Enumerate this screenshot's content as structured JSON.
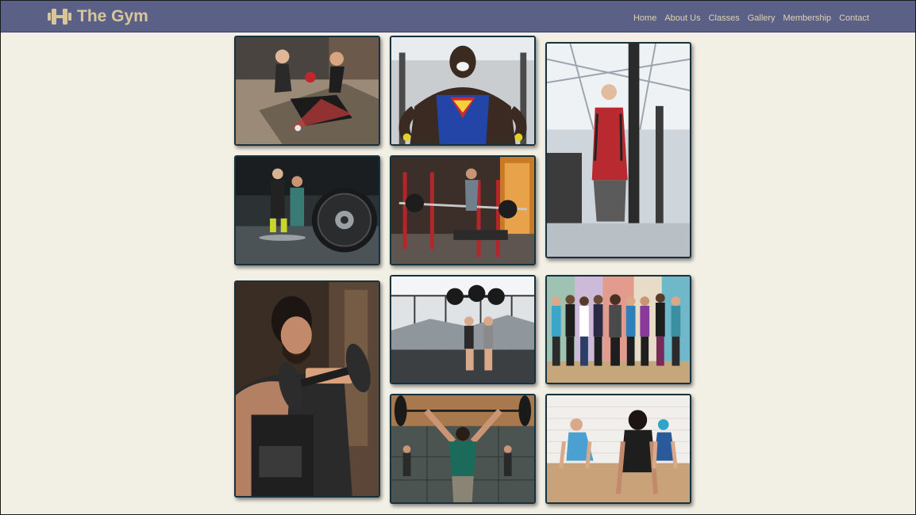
{
  "brand": {
    "name": "The Gym",
    "logo_icon": "dumbbell-icon",
    "color": "#d8c59a"
  },
  "nav": {
    "links": [
      {
        "label": "Home"
      },
      {
        "label": "About Us"
      },
      {
        "label": "Classes"
      },
      {
        "label": "Gallery"
      },
      {
        "label": "Membership"
      },
      {
        "label": "Contact"
      }
    ]
  },
  "gallery": {
    "photos": [
      {
        "subject": "two women exercising with medicine ball"
      },
      {
        "subject": "bodybuilder in superman tank top at cable machine"
      },
      {
        "subject": "man doing cable exercise in gym"
      },
      {
        "subject": "weight plate on barbell with people in background"
      },
      {
        "subject": "man bench pressing with spotter"
      },
      {
        "subject": "bearded man curling dumbbell"
      },
      {
        "subject": "two people lifting barbells overhead"
      },
      {
        "subject": "group of women posing in fitness studio"
      },
      {
        "subject": "man lifting barbell overhead in crossfit gym"
      },
      {
        "subject": "women doing push-ups in studio"
      }
    ]
  },
  "colors": {
    "navbar": "#5b6186",
    "background": "#f2efe5",
    "nav_text": "#ddd2b2",
    "tile_border": "#16323e"
  }
}
